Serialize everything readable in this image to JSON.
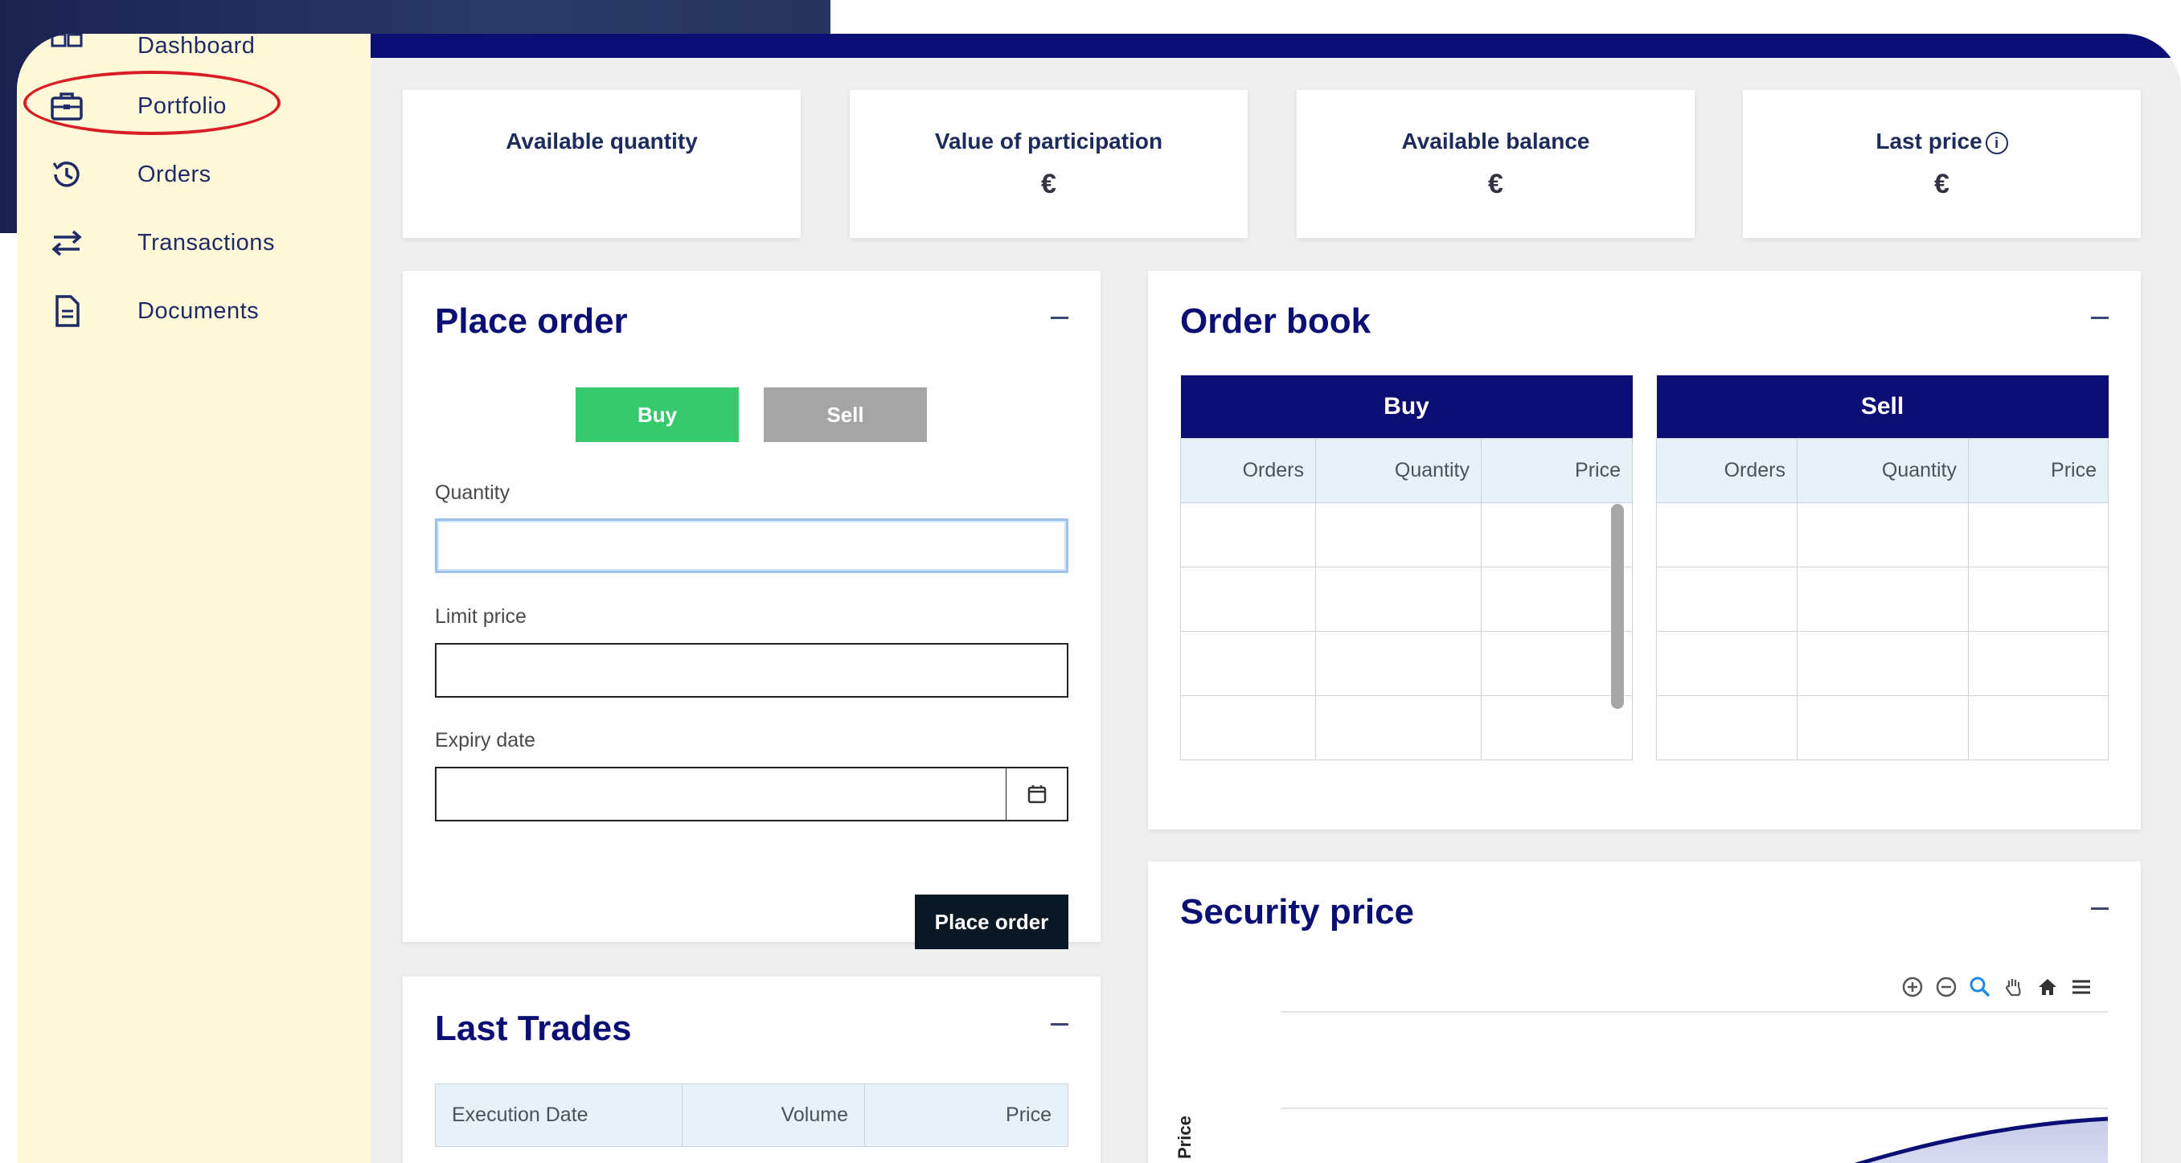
{
  "sidebar": {
    "items": [
      {
        "label": "Dashboard",
        "icon": "dashboard-icon"
      },
      {
        "label": "Portfolio",
        "icon": "briefcase-icon"
      },
      {
        "label": "Orders",
        "icon": "history-icon"
      },
      {
        "label": "Transactions",
        "icon": "transfer-arrows-icon"
      },
      {
        "label": "Documents",
        "icon": "document-icon"
      }
    ]
  },
  "stats": [
    {
      "label": "Available quantity",
      "value": ""
    },
    {
      "label": "Value of participation",
      "value": "€"
    },
    {
      "label": "Available balance",
      "value": "€"
    },
    {
      "label": "Last price",
      "value": "€"
    }
  ],
  "place_order": {
    "title": "Place order",
    "buy_label": "Buy",
    "sell_label": "Sell",
    "quantity_label": "Quantity",
    "quantity_value": "",
    "limit_label": "Limit price",
    "limit_value": "",
    "expiry_label": "Expiry date",
    "expiry_value": "",
    "submit_label": "Place order"
  },
  "order_book": {
    "title": "Order book",
    "buy_header": "Buy",
    "sell_header": "Sell",
    "columns": [
      "Orders",
      "Quantity",
      "Price"
    ]
  },
  "security_price": {
    "title": "Security price",
    "y_label": "Price"
  },
  "last_trades": {
    "title": "Last Trades",
    "columns": [
      "Execution Date",
      "Volume",
      "Price"
    ]
  },
  "colors": {
    "navy": "#0b0f73",
    "sidebar_bg": "#fff9da",
    "buy_green": "#37c96d",
    "sell_gray": "#a5a5a5",
    "highlight_red": "#d91d24"
  }
}
